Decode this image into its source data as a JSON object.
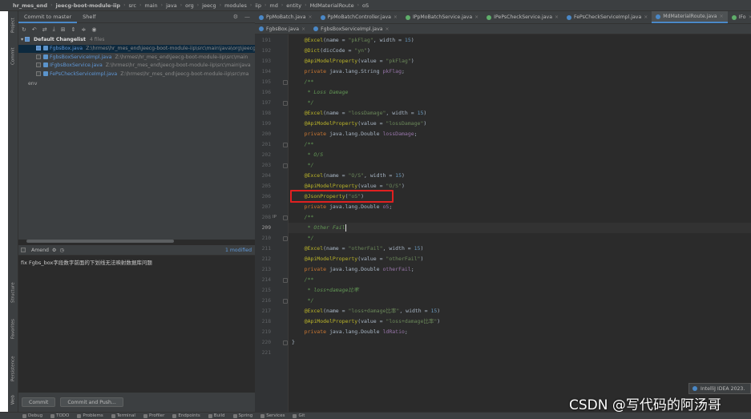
{
  "breadcrumb": [
    "hr_mes_end",
    "jeecg-boot-module-iip",
    "src",
    "main",
    "java",
    "org",
    "jeecg",
    "modules",
    "iip",
    "md",
    "entity",
    "MdMaterialRoute",
    "oS"
  ],
  "stripe_labels": {
    "project": "Project",
    "commit": "Commit",
    "structure": "Structure",
    "favorites": "Favorites",
    "persistence": "Persistence",
    "web": "Web"
  },
  "commit_panel": {
    "tab_commit": "Commit to master",
    "tab_shelf": "Shelf",
    "changelist": "Default Changelist",
    "changelist_count": "4 files",
    "files": [
      {
        "name": "FgbsBox.java",
        "path": "Z:\\hrmes\\hr_mes_end\\jeecg-boot-module-iip\\src\\main\\java\\org\\jeecg",
        "checked": true
      },
      {
        "name": "FgbsBoxServiceImpl.java",
        "path": "Z:\\hrmes\\hr_mes_end\\jeecg-boot-module-iip\\src\\main",
        "checked": false
      },
      {
        "name": "IFgbsBoxService.java",
        "path": "Z:\\hrmes\\hr_mes_end\\jeecg-boot-module-iip\\src\\main\\java",
        "checked": false
      },
      {
        "name": "FePsCheckServiceImpl.java",
        "path": "Z:\\hrmes\\hr_mes_end\\jeecg-boot-module-iip\\src\\ma",
        "checked": false
      }
    ],
    "env_label": "env",
    "amend": "Amend",
    "modified": "1 modified",
    "message": "fix Fgbs_box字段数字前面的下划线无法映射数据库问题",
    "commit_btn": "Commit",
    "commit_push_btn": "Commit and Push..."
  },
  "tabs_row1": [
    {
      "label": "PpMoBatch.java",
      "icon": "c"
    },
    {
      "label": "PpMoBatchController.java",
      "icon": "c"
    },
    {
      "label": "IPpMoBatchService.java",
      "icon": "i"
    },
    {
      "label": "IPePsCheckService.java",
      "icon": "i"
    },
    {
      "label": "FePsCheckServiceImpl.java",
      "icon": "c"
    },
    {
      "label": "MdMaterialRoute.java",
      "icon": "c",
      "active": true
    },
    {
      "label": "IFo",
      "icon": "i"
    }
  ],
  "tabs_row2": [
    {
      "label": "FgbsBox.java",
      "icon": "c"
    },
    {
      "label": "FgbsBoxServiceImpl.java",
      "icon": "c"
    }
  ],
  "code_lines": [
    {
      "n": "191",
      "html": "    <span class='ann'>@Excel</span>(name = <span class='str'>\"pkFlag\"</span>, width = <span class='num'>15</span>)"
    },
    {
      "n": "192",
      "html": "    <span class='ann'>@Dict</span>(dicCode = <span class='str'>\"yn\"</span>)"
    },
    {
      "n": "193",
      "html": "    <span class='ann'>@ApiModelProperty</span>(value = <span class='str'>\"pkFlag\"</span>)"
    },
    {
      "n": "194",
      "html": "    <span class='kw'>private</span> java.lang.String <span class='fld'>pkFlag</span>;"
    },
    {
      "n": "195",
      "html": "    <span class='cmt'>/**</span>"
    },
    {
      "n": "196",
      "html": "    <span class='cmt'> * Loss Damage</span>"
    },
    {
      "n": "197",
      "html": "    <span class='cmt'> */</span>"
    },
    {
      "n": "198",
      "html": "    <span class='ann'>@Excel</span>(name = <span class='str'>\"lossDamage\"</span>, width = <span class='num'>15</span>)"
    },
    {
      "n": "199",
      "html": "    <span class='ann'>@ApiModelProperty</span>(value = <span class='str'>\"lossDamage\"</span>)"
    },
    {
      "n": "200",
      "html": "    <span class='kw'>private</span> java.lang.Double <span class='fld'>lossDamage</span>;"
    },
    {
      "n": "201",
      "html": "    <span class='cmt'>/**</span>"
    },
    {
      "n": "202",
      "html": "    <span class='cmt'> * O/S</span>"
    },
    {
      "n": "203",
      "html": "    <span class='cmt'> */</span>"
    },
    {
      "n": "204",
      "html": "    <span class='ann'>@Excel</span>(name = <span class='str'>\"O/S\"</span>, width = <span class='num'>15</span>)"
    },
    {
      "n": "205",
      "html": "    <span class='ann'>@ApiModelProperty</span>(value = <span class='str'>\"O/S\"</span>)"
    },
    {
      "n": "206",
      "html": "    <span class='ann'>@JsonProperty</span>(<span class='str'>\"oS\"</span>)"
    },
    {
      "n": "207",
      "html": "    <span class='kw'>private</span> java.lang.Double <span class='fld'>oS</span>;"
    },
    {
      "n": "208",
      "html": "    <span class='cmt'>/**</span>"
    },
    {
      "n": "209",
      "html": "    <span class='cmt'> * Other Fail</span>",
      "current": true
    },
    {
      "n": "210",
      "html": "    <span class='cmt'> */</span>"
    },
    {
      "n": "211",
      "html": "    <span class='ann'>@Excel</span>(name = <span class='str'>\"otherFail\"</span>, width = <span class='num'>15</span>)"
    },
    {
      "n": "212",
      "html": "    <span class='ann'>@ApiModelProperty</span>(value = <span class='str'>\"otherFail\"</span>)"
    },
    {
      "n": "213",
      "html": "    <span class='kw'>private</span> java.lang.Double <span class='fld'>otherFail</span>;"
    },
    {
      "n": "214",
      "html": "    <span class='cmt'>/**</span>"
    },
    {
      "n": "215",
      "html": "    <span class='cmt'> * loss+damage比率</span>"
    },
    {
      "n": "216",
      "html": "    <span class='cmt'> */</span>"
    },
    {
      "n": "217",
      "html": "    <span class='ann'>@Excel</span>(name = <span class='str'>\"loss+damage比率\"</span>, width = <span class='num'>15</span>)"
    },
    {
      "n": "218",
      "html": "    <span class='ann'>@ApiModelProperty</span>(value = <span class='str'>\"loss+damage比率\"</span>)"
    },
    {
      "n": "219",
      "html": "    <span class='kw'>private</span> java.lang.Double <span class='fld'>ldRatio</span>;"
    },
    {
      "n": "220",
      "html": "}"
    },
    {
      "n": "221",
      "html": ""
    }
  ],
  "gutter_marks": {
    "208": "IP"
  },
  "notification": "IntelliJ IDEA 2023.",
  "watermark": "CSDN @写代码的阿汤哥",
  "bottom_tools": [
    "Debug",
    "TODO",
    "Problems",
    "Terminal",
    "Profiler",
    "Endpoints",
    "Build",
    "Spring",
    "Services",
    "Git"
  ]
}
